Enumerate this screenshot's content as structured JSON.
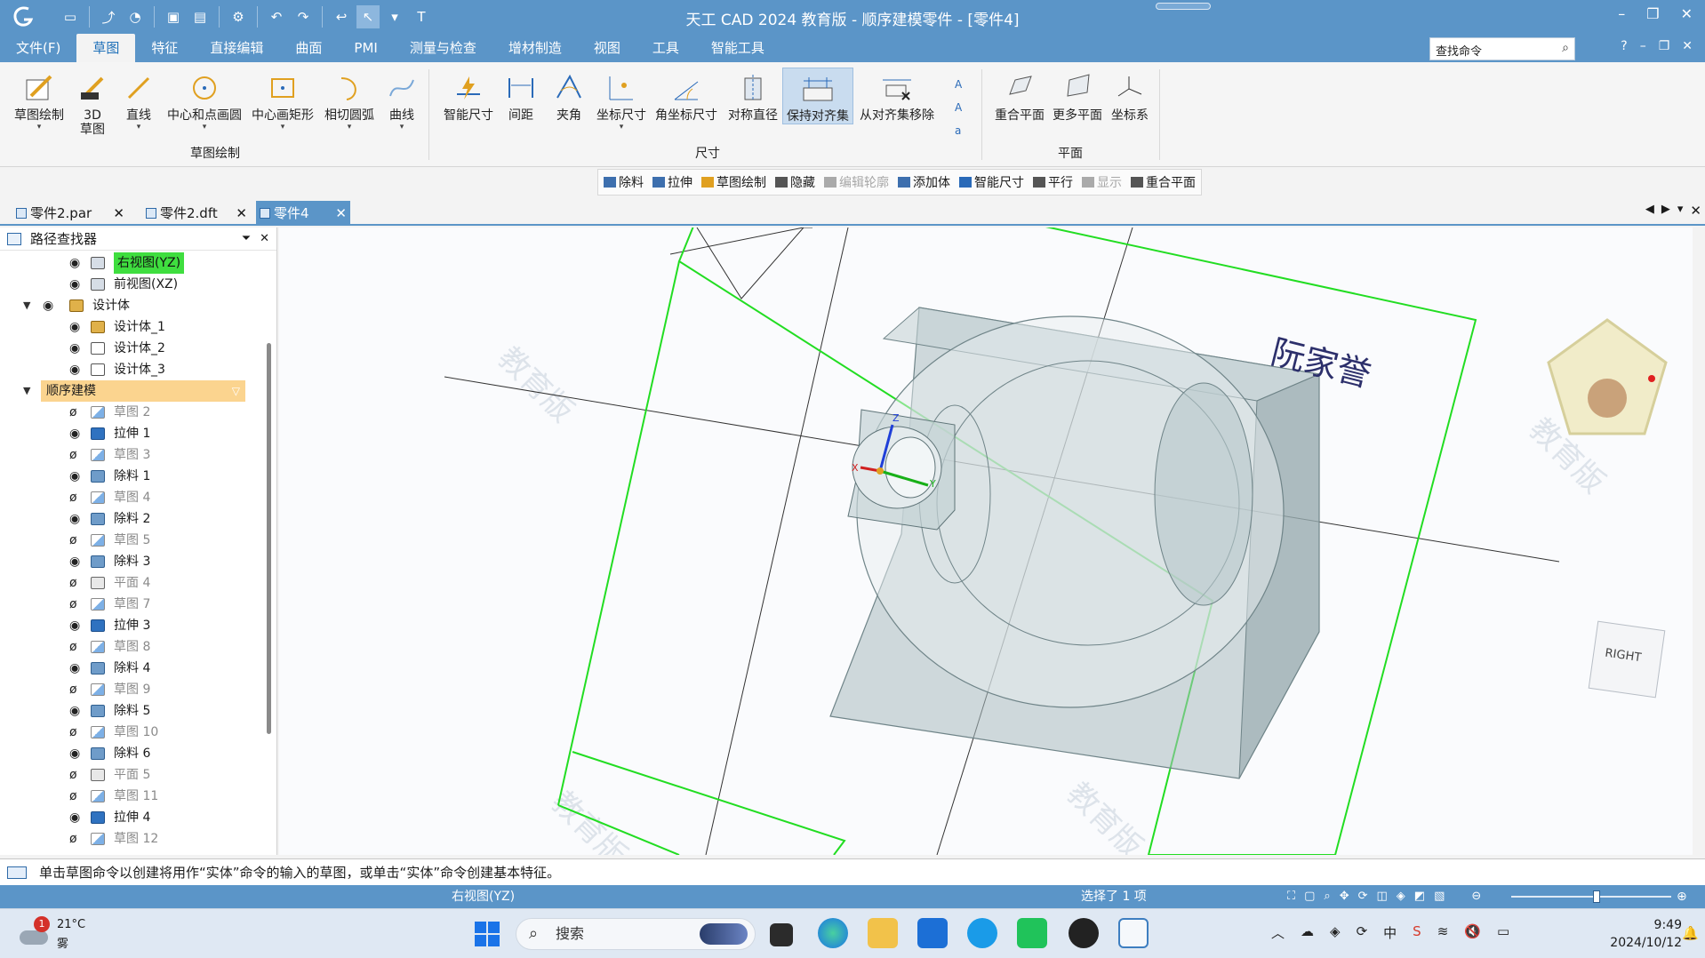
{
  "window": {
    "title": "天工 CAD 2024 教育版 - 顺序建模零件 - [零件4]"
  },
  "menu": {
    "tabs": [
      "文件(F)",
      "草图",
      "特征",
      "直接编辑",
      "曲面",
      "PMI",
      "测量与检查",
      "增材制造",
      "视图",
      "工具",
      "智能工具"
    ],
    "active_index": 1,
    "search_placeholder": "查找命令"
  },
  "ribbon": {
    "sketch_group": {
      "label": "草图绘制",
      "buttons": [
        "草图绘制",
        "3D 草图",
        "直线",
        "中心和点画圆",
        "中心画矩形",
        "相切圆弧",
        "曲线"
      ]
    },
    "dimension_group": {
      "label": "尺寸",
      "buttons": [
        "智能尺寸",
        "间距",
        "夹角",
        "坐标尺寸",
        "角坐标尺寸",
        "对称直径",
        "保持对齐集",
        "从对齐集移除"
      ]
    },
    "plane_group": {
      "label": "平面",
      "buttons": [
        "重合平面",
        "更多平面",
        "坐标系"
      ]
    }
  },
  "context_toolbar": [
    {
      "label": "除料",
      "enabled": true
    },
    {
      "label": "拉伸",
      "enabled": true
    },
    {
      "label": "草图绘制",
      "enabled": true
    },
    {
      "label": "隐藏",
      "enabled": true
    },
    {
      "label": "编辑轮廓",
      "enabled": false
    },
    {
      "label": "添加体",
      "enabled": true
    },
    {
      "label": "智能尺寸",
      "enabled": true
    },
    {
      "label": "平行",
      "enabled": true
    },
    {
      "label": "显示",
      "enabled": false
    },
    {
      "label": "重合平面",
      "enabled": true
    }
  ],
  "doc_tabs": [
    {
      "label": "零件2.par",
      "active": false
    },
    {
      "label": "零件2.dft",
      "active": false
    },
    {
      "label": "零件4",
      "active": true
    }
  ],
  "pathfinder": {
    "title": "路径查找器",
    "items": [
      {
        "label": "右视图(YZ)",
        "icon": "view-icon",
        "level": 2,
        "style": "hl-green"
      },
      {
        "label": "前视图(XZ)",
        "icon": "view-icon",
        "level": 2,
        "style": ""
      },
      {
        "label": "设计体",
        "icon": "body-icon",
        "level": 1,
        "style": "",
        "expander": "▼"
      },
      {
        "label": "设计体_1",
        "icon": "body-icon",
        "level": 2,
        "style": ""
      },
      {
        "label": "设计体_2",
        "icon": "body-outline-icon",
        "level": 2,
        "style": ""
      },
      {
        "label": "设计体_3",
        "icon": "body-outline-icon",
        "level": 2,
        "style": ""
      },
      {
        "label": "顺序建模",
        "icon": "",
        "level": 0,
        "style": "hl-orange",
        "expander": "▼"
      },
      {
        "label": "草图 2",
        "icon": "sketch-icon",
        "level": 2,
        "style": "dim",
        "hidden": true
      },
      {
        "label": "拉伸 1",
        "icon": "extrude-icon",
        "level": 2,
        "style": ""
      },
      {
        "label": "草图 3",
        "icon": "sketch-icon",
        "level": 2,
        "style": "dim",
        "hidden": true
      },
      {
        "label": "除料 1",
        "icon": "cut-icon",
        "level": 2,
        "style": ""
      },
      {
        "label": "草图 4",
        "icon": "sketch-icon",
        "level": 2,
        "style": "dim",
        "hidden": true
      },
      {
        "label": "除料 2",
        "icon": "cut-icon",
        "level": 2,
        "style": ""
      },
      {
        "label": "草图 5",
        "icon": "sketch-icon",
        "level": 2,
        "style": "dim",
        "hidden": true
      },
      {
        "label": "除料 3",
        "icon": "cut-icon",
        "level": 2,
        "style": ""
      },
      {
        "label": "平面 4",
        "icon": "plane-icon",
        "level": 2,
        "style": "dim",
        "hidden": true
      },
      {
        "label": "草图 7",
        "icon": "sketch-icon",
        "level": 2,
        "style": "dim",
        "hidden": true
      },
      {
        "label": "拉伸 3",
        "icon": "extrude-icon",
        "level": 2,
        "style": ""
      },
      {
        "label": "草图 8",
        "icon": "sketch-icon",
        "level": 2,
        "style": "dim",
        "hidden": true
      },
      {
        "label": "除料 4",
        "icon": "cut-icon",
        "level": 2,
        "style": ""
      },
      {
        "label": "草图 9",
        "icon": "sketch-icon",
        "level": 2,
        "style": "dim",
        "hidden": true
      },
      {
        "label": "除料 5",
        "icon": "cut-icon",
        "level": 2,
        "style": ""
      },
      {
        "label": "草图 10",
        "icon": "sketch-icon",
        "level": 2,
        "style": "dim",
        "hidden": true
      },
      {
        "label": "除料 6",
        "icon": "cut-icon",
        "level": 2,
        "style": ""
      },
      {
        "label": "平面 5",
        "icon": "plane-icon",
        "level": 2,
        "style": "dim",
        "hidden": true
      },
      {
        "label": "草图 11",
        "icon": "sketch-icon",
        "level": 2,
        "style": "dim",
        "hidden": true
      },
      {
        "label": "拉伸 4",
        "icon": "extrude-icon",
        "level": 2,
        "style": ""
      },
      {
        "label": "草图 12",
        "icon": "sketch-icon",
        "level": 2,
        "style": "dim",
        "hidden": true
      }
    ]
  },
  "viewport": {
    "name_label": "阮家誉",
    "watermark": "教育版",
    "view_cube_label": "RIGHT",
    "triad": {
      "x": "X",
      "y": "Y",
      "z": "Z"
    },
    "sketch_color": "#22dd22",
    "body_color": "#a9bcc0"
  },
  "prompt": {
    "text": "单击草图命令以创建将用作“实体”命令的输入的草图，或单击“实体”命令创建基本特征。"
  },
  "status": {
    "view_name": "右视图(YZ)",
    "selection": "选择了 1 项"
  },
  "taskbar": {
    "weather_badge": "1",
    "temperature": "21°C",
    "condition": "雾",
    "search_label": "搜索",
    "ime": "中",
    "time": "9:49",
    "date": "2024/10/12"
  },
  "colors": {
    "accent": "#5b95c8",
    "active_tab_text": "#1d6fb8"
  }
}
